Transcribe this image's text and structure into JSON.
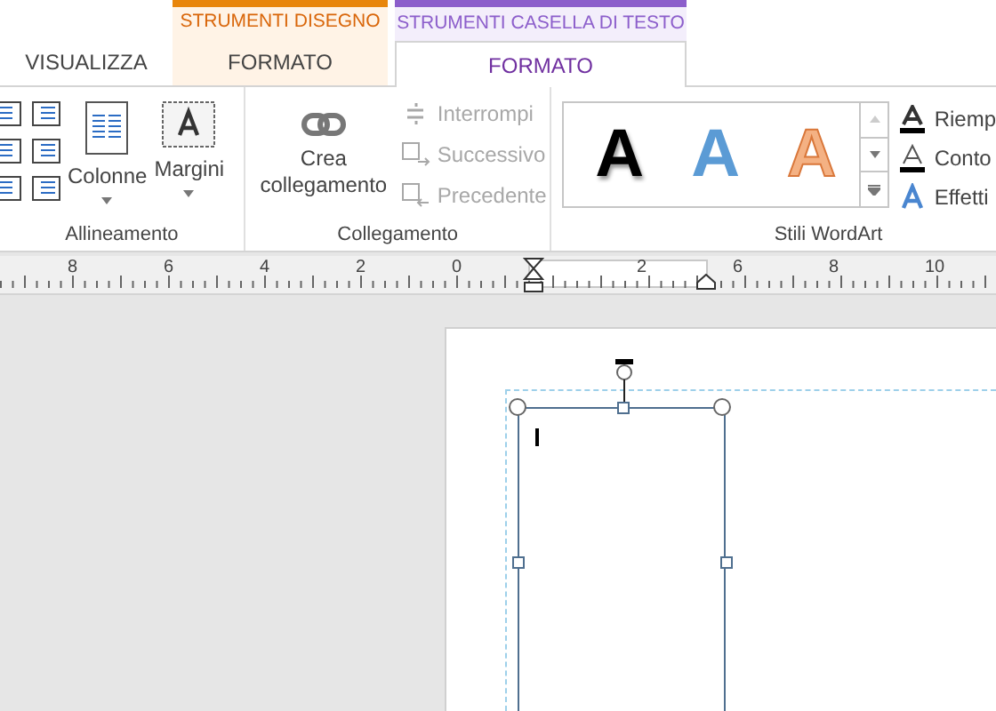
{
  "tabs": [
    {
      "label": "VISUALIZZA",
      "selected": false
    }
  ],
  "contextual_tabs": [
    {
      "label": "STRUMENTI DISEGNO",
      "color": "#e8860c",
      "tabs": [
        {
          "label": "FORMATO",
          "selected": false
        }
      ]
    },
    {
      "label": "STRUMENTI CASELLA DI TESTO",
      "color": "#8c5ecb",
      "tabs": [
        {
          "label": "FORMATO",
          "selected": true
        }
      ]
    }
  ],
  "groups": [
    {
      "label": "Allineamento",
      "buttons": [
        {
          "label": "Colonne",
          "kind": "columns"
        },
        {
          "label": "Margini",
          "kind": "margins"
        }
      ]
    },
    {
      "label": "Collegamento",
      "main": {
        "label": "Crea collegamento"
      },
      "items": [
        {
          "label": "Interrompi",
          "kind": "break",
          "disabled": true
        },
        {
          "label": "Successivo",
          "kind": "next",
          "disabled": true
        },
        {
          "label": "Precedente",
          "kind": "previous",
          "disabled": true
        }
      ]
    },
    {
      "label": "Stili WordArt",
      "styles": [
        {
          "glyph": "A",
          "color": "#000000"
        },
        {
          "glyph": "A",
          "color": "#5b9bd5"
        },
        {
          "glyph": "A",
          "color": "#f4b183"
        }
      ],
      "items": [
        {
          "label": "Riemp",
          "kind": "fill"
        },
        {
          "label": "Conto",
          "kind": "outline"
        },
        {
          "label": "Effetti",
          "kind": "effects"
        }
      ]
    }
  ],
  "ruler": {
    "labels": [
      "8",
      "6",
      "4",
      "2",
      "0",
      "2",
      "6",
      "8",
      "10"
    ]
  }
}
